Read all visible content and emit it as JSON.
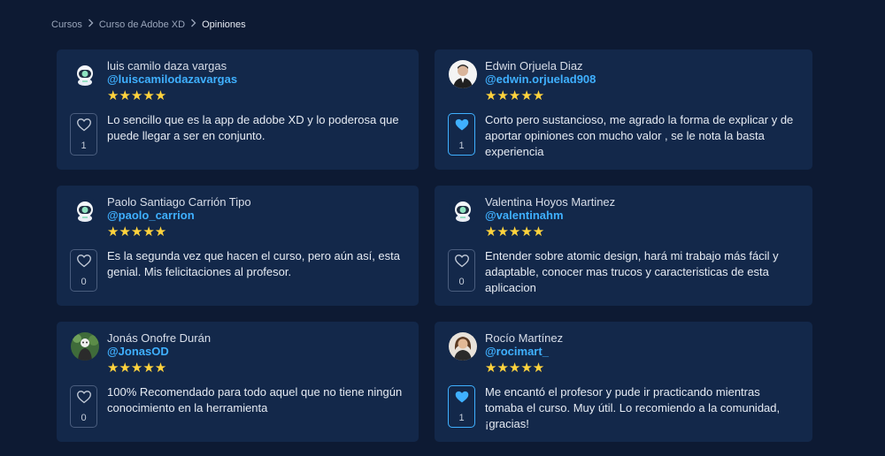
{
  "breadcrumb": {
    "items": [
      "Cursos",
      "Curso de Adobe XD"
    ],
    "current": "Opiniones"
  },
  "colors": {
    "background": "#0d1a33",
    "card": "#13284a",
    "accent": "#3fb0ff",
    "star": "#ffd33d"
  },
  "reviews": [
    {
      "name": "luis camilo daza vargas",
      "handle": "@luiscamilodazavargas",
      "avatar": "astronaut-avatar",
      "stars": "★★★★★",
      "likes": "1",
      "liked": false,
      "comment": "Lo sencillo que es la app de adobe XD y lo poderosa que puede llegar a ser en conjunto."
    },
    {
      "name": "Edwin Orjuela Diaz",
      "handle": "@edwin.orjuelad908",
      "avatar": "photo-avatar-man",
      "stars": "★★★★★",
      "likes": "1",
      "liked": true,
      "comment": "Corto pero sustancioso, me agrado la forma de explicar y de aportar opiniones con mucho valor , se le nota la basta experiencia"
    },
    {
      "name": "Paolo Santiago Carrión Tipo",
      "handle": "@paolo_carrion",
      "avatar": "astronaut-avatar",
      "stars": "★★★★★",
      "likes": "0",
      "liked": false,
      "comment": "Es la segunda vez que hacen el curso, pero aún así, esta genial. Mis felicitaciones al profesor."
    },
    {
      "name": "Valentina Hoyos Martinez",
      "handle": "@valentinahm",
      "avatar": "astronaut-avatar",
      "stars": "★★★★★",
      "likes": "0",
      "liked": false,
      "comment": "Entender sobre atomic design, hará mi trabajo más fácil y adaptable, conocer mas trucos y caracteristicas de esta aplicacion"
    },
    {
      "name": "Jonás Onofre Durán",
      "handle": "@JonasOD",
      "avatar": "photo-avatar-green",
      "stars": "★★★★★",
      "likes": "0",
      "liked": false,
      "comment": "100% Recomendado para todo aquel que no tiene ningún conocimiento en la herramienta"
    },
    {
      "name": "Rocío Martínez",
      "handle": "@rocimart_",
      "avatar": "photo-avatar-woman",
      "stars": "★★★★★",
      "likes": "1",
      "liked": true,
      "comment": "Me encantó el profesor y pude ir practicando mientras tomaba el curso. Muy útil. Lo recomiendo a la comunidad, ¡gracias!"
    }
  ]
}
